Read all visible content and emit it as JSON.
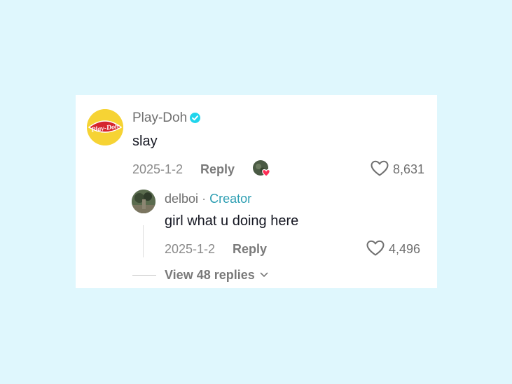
{
  "comment": {
    "author": "Play-Doh",
    "avatar_logo_text": "Play-Doh",
    "text": "slay",
    "date": "2025-1-2",
    "reply_label": "Reply",
    "likes": "8,631",
    "creator_liked": true
  },
  "reply": {
    "author": "delboi",
    "separator": "·",
    "tag": "Creator",
    "text": "girl what u doing here",
    "date": "2025-1-2",
    "reply_label": "Reply",
    "likes": "4,496"
  },
  "view_replies": {
    "label": "View 48 replies"
  },
  "colors": {
    "background": "#dff7fd",
    "verified": "#20d5ec",
    "creator_tag": "#2e9fb3",
    "heart_badge": "#fe2c55"
  }
}
